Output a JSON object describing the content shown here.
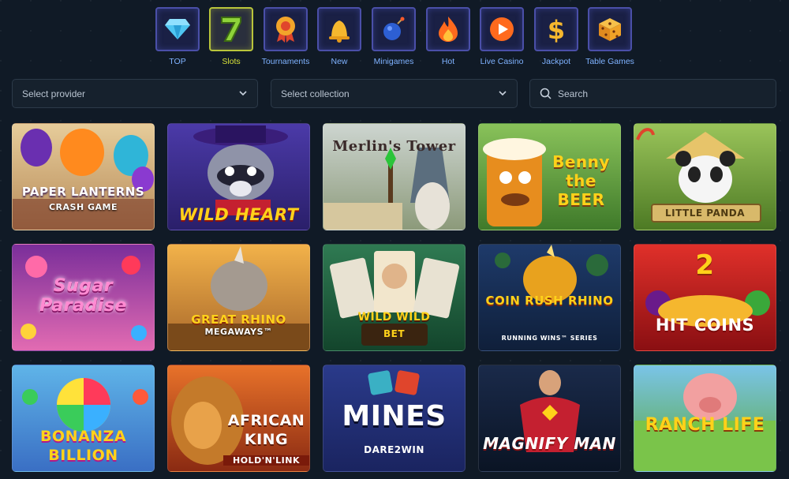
{
  "categories": [
    {
      "label": "TOP",
      "icon": "diamond-icon",
      "active": false
    },
    {
      "label": "Slots",
      "icon": "seven-icon",
      "active": true
    },
    {
      "label": "Tournaments",
      "icon": "medal-icon",
      "active": false
    },
    {
      "label": "New",
      "icon": "bell-icon",
      "active": false
    },
    {
      "label": "Minigames",
      "icon": "bomb-icon",
      "active": false
    },
    {
      "label": "Hot",
      "icon": "flame-icon",
      "active": false
    },
    {
      "label": "Live Casino",
      "icon": "play-icon",
      "active": false
    },
    {
      "label": "Jackpot",
      "icon": "dollar-icon",
      "active": false
    },
    {
      "label": "Table Games",
      "icon": "dice-icon",
      "active": false
    }
  ],
  "filters": {
    "provider_placeholder": "Select provider",
    "collection_placeholder": "Select collection",
    "search_placeholder": "Search"
  },
  "games": [
    {
      "title": "PAPER LANTERNS",
      "subtitle": "CRASH GAME"
    },
    {
      "title": "WILD HEART",
      "subtitle": ""
    },
    {
      "title": "Merlin's Tower",
      "subtitle": ""
    },
    {
      "title": "Benny the BEER",
      "subtitle": ""
    },
    {
      "title": "LITTLE PANDA",
      "subtitle": ""
    },
    {
      "title": "Sugar Paradise",
      "subtitle": ""
    },
    {
      "title": "GREAT RHINO",
      "subtitle": "MEGAWAYS™"
    },
    {
      "title": "WILD WILD",
      "subtitle": "BET"
    },
    {
      "title": "COIN RUSH RHINO",
      "subtitle": "RUNNING WINS™ SERIES"
    },
    {
      "title": "HIT COINS",
      "subtitle": "2"
    },
    {
      "title": "BONANZA BILLION",
      "subtitle": ""
    },
    {
      "title": "AFRICAN KING",
      "subtitle": "HOLD'N'LINK"
    },
    {
      "title": "MINES",
      "subtitle": "DARE2WIN"
    },
    {
      "title": "MAGNIFY MAN",
      "subtitle": ""
    },
    {
      "title": "RANCH LIFE",
      "subtitle": ""
    }
  ]
}
